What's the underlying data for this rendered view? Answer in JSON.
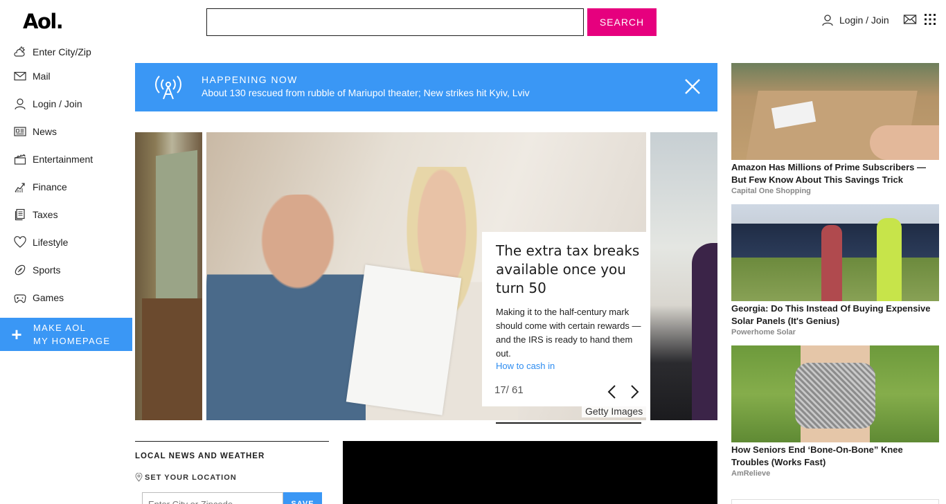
{
  "header": {
    "logo": "Aol.",
    "search_placeholder": "",
    "search_button": "SEARCH",
    "login_label": "Login / Join"
  },
  "sidebar": {
    "items": [
      {
        "label": "Enter City/Zip",
        "icon": "weather-icon"
      },
      {
        "label": "Mail",
        "icon": "mail-icon"
      },
      {
        "label": "Login / Join",
        "icon": "user-icon"
      },
      {
        "label": "News",
        "icon": "news-icon"
      },
      {
        "label": "Entertainment",
        "icon": "clapper-icon"
      },
      {
        "label": "Finance",
        "icon": "chart-icon"
      },
      {
        "label": "Taxes",
        "icon": "document-icon"
      },
      {
        "label": "Lifestyle",
        "icon": "heart-icon"
      },
      {
        "label": "Sports",
        "icon": "football-icon"
      },
      {
        "label": "Games",
        "icon": "gamepad-icon"
      }
    ],
    "homepage_line1": "MAKE AOL",
    "homepage_line2": "MY HOMEPAGE"
  },
  "banner": {
    "title": "HAPPENING NOW",
    "text": "About 130 rescued from rubble of Mariupol theater; New strikes hit Kyiv, Lviv"
  },
  "carousel": {
    "title": "The extra tax breaks available once you turn 50",
    "body": "Making it to the half-century mark should come with certain rewards — and the IRS is ready to hand them out.",
    "link": "How to cash in",
    "counter": "17/ 61",
    "credit": "Getty Images"
  },
  "local": {
    "title": "LOCAL NEWS AND WEATHER",
    "set_location": "SET YOUR LOCATION",
    "input_placeholder": "Enter City or Zipcode",
    "save": "SAVE"
  },
  "ads": [
    {
      "title": "Amazon Has Millions of Prime Subscribers — But Few Know About This Savings Trick",
      "source": "Capital One Shopping"
    },
    {
      "title": "Georgia: Do This Instead Of Buying Expensive Solar Panels (It's Genius)",
      "source": "Powerhome Solar"
    },
    {
      "title": "How Seniors End ‘Bone-On-Bone” Knee Troubles (Works Fast)",
      "source": "AmRelieve"
    }
  ],
  "colors": {
    "accent_pink": "#e6007e",
    "accent_blue": "#3a97f5"
  }
}
